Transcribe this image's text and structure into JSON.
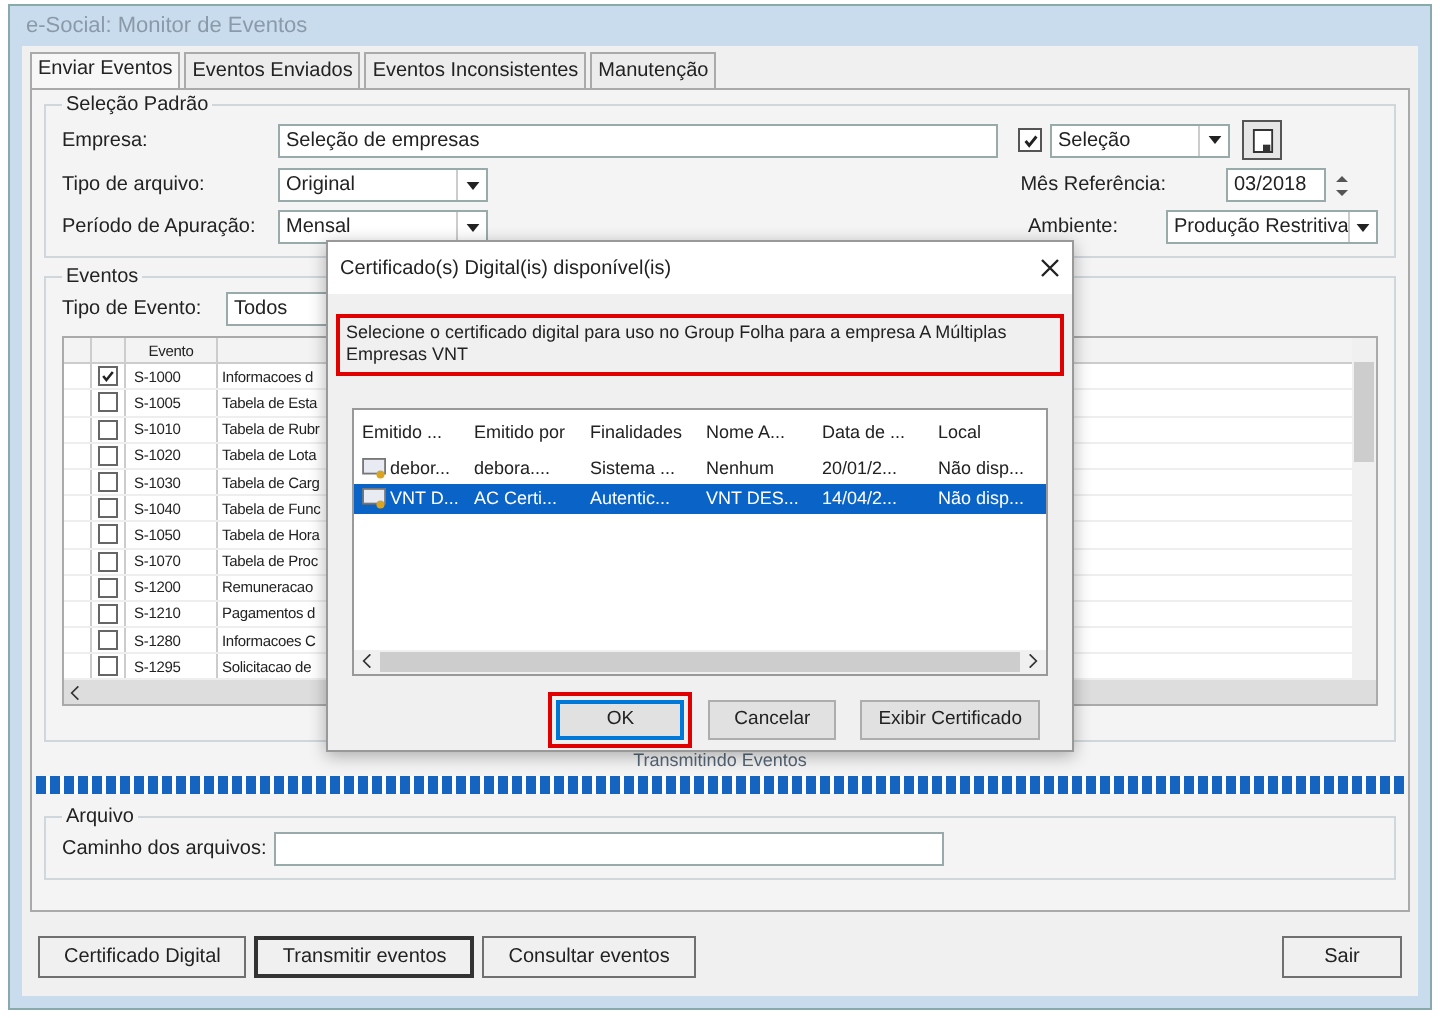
{
  "window": {
    "title": "e-Social: Monitor de Eventos"
  },
  "tabs": [
    {
      "label": "Enviar Eventos",
      "selected": true
    },
    {
      "label": "Eventos Enviados",
      "selected": false
    },
    {
      "label": "Eventos Inconsistentes",
      "selected": false
    },
    {
      "label": "Manutenção",
      "selected": false
    }
  ],
  "selecao_padrao": {
    "legend": "Seleção Padrão",
    "empresa_label": "Empresa:",
    "empresa_value": "Seleção de empresas",
    "selecao_checked": true,
    "selecao_value": "Seleção",
    "tipo_label": "Tipo de arquivo:",
    "tipo_value": "Original",
    "mes_label": "Mês Referência:",
    "mes_value": "03/2018",
    "periodo_label": "Período de Apuração:",
    "periodo_value": "Mensal",
    "ambiente_label": "Ambiente:",
    "ambiente_value": "Produção Restritiva"
  },
  "eventos": {
    "legend": "Eventos",
    "tipo_label": "Tipo de Evento:",
    "tipo_value": "Todos",
    "column_header": "Evento",
    "rows": [
      {
        "checked": true,
        "code": "S-1000",
        "description": "Informacoes d"
      },
      {
        "checked": false,
        "code": "S-1005",
        "description": "Tabela de Esta"
      },
      {
        "checked": false,
        "code": "S-1010",
        "description": "Tabela de Rubr"
      },
      {
        "checked": false,
        "code": "S-1020",
        "description": "Tabela de Lota"
      },
      {
        "checked": false,
        "code": "S-1030",
        "description": "Tabela de Carg"
      },
      {
        "checked": false,
        "code": "S-1040",
        "description": "Tabela de Func"
      },
      {
        "checked": false,
        "code": "S-1050",
        "description": "Tabela de Hora"
      },
      {
        "checked": false,
        "code": "S-1070",
        "description": "Tabela de Proc"
      },
      {
        "checked": false,
        "code": "S-1200",
        "description": "Remuneracao"
      },
      {
        "checked": false,
        "code": "S-1210",
        "description": "Pagamentos d"
      },
      {
        "checked": false,
        "code": "S-1280",
        "description": "Informacoes C"
      },
      {
        "checked": false,
        "code": "S-1295",
        "description": "Solicitacao de"
      }
    ]
  },
  "progress": {
    "label": "Transmitindo Eventos",
    "level": 1
  },
  "arquivo": {
    "legend": "Arquivo",
    "caminho_label": "Caminho dos arquivos:"
  },
  "buttons": [
    {
      "label": "Certificado Digital",
      "default": false
    },
    {
      "label": "Transmitir eventos",
      "default": true
    },
    {
      "label": "Consultar eventos",
      "default": false
    }
  ],
  "exit_button": "Sair",
  "dialog": {
    "title": "Certificado(s) Digital(is) disponível(is)",
    "message": "Selecione o certificado digital para uso no Group Folha para a empresa A Múltiplas Empresas VNT",
    "message_highlighted": true,
    "columns": [
      "Emitido ...",
      "Emitido por",
      "Finalidades",
      "Nome A...",
      "Data de ...",
      "Local"
    ],
    "rows": [
      {
        "selected": false,
        "cells": [
          "debor...",
          "debora....",
          "Sistema ...",
          "Nenhum",
          "20/01/2...",
          "Não disp..."
        ]
      },
      {
        "selected": true,
        "cells": [
          "VNT D...",
          "AC Certi...",
          "Autentic...",
          "VNT DES...",
          "14/04/2...",
          "Não disp..."
        ]
      }
    ],
    "buttons": [
      {
        "label": "OK",
        "highlighted": true
      },
      {
        "label": "Cancelar",
        "highlighted": false
      },
      {
        "label": "Exibir Certificado",
        "highlighted": false
      }
    ]
  }
}
